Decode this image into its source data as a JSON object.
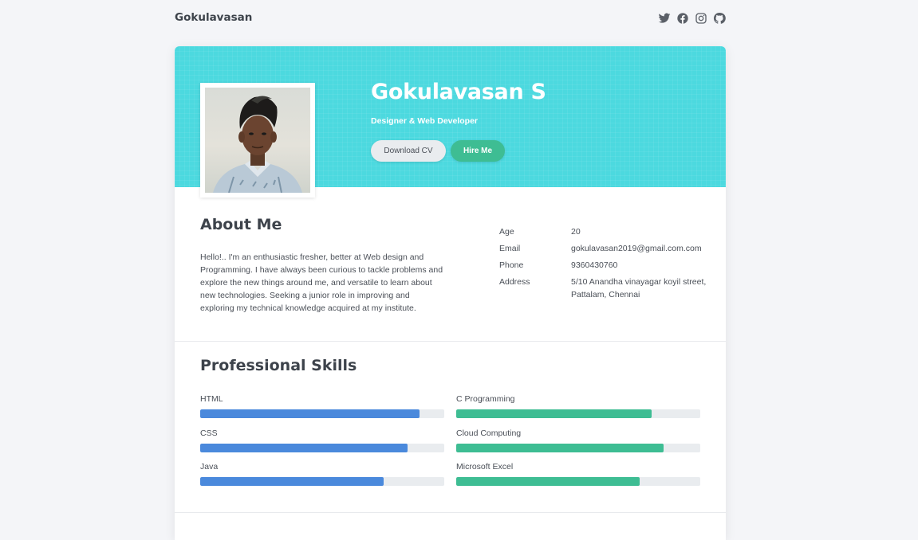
{
  "header": {
    "brand": "Gokulavasan",
    "social_icons": [
      "twitter-icon",
      "facebook-icon",
      "instagram-icon",
      "github-icon"
    ]
  },
  "profile": {
    "name": "Gokulavasan S",
    "role": "Designer & Web Developer",
    "download_label": "Download CV",
    "hire_label": "Hire Me"
  },
  "about": {
    "title": "About Me",
    "text": "Hello!.. I'm an enthusiastic fresher, better at Web design and Programming. I have always been curious to tackle problems and explore the new things around me, and versatile to learn about new technologies. Seeking a junior role in improving and exploring my technical knowledge acquired at my institute.",
    "info": [
      {
        "label": "Age",
        "value": "20"
      },
      {
        "label": "Email",
        "value": "gokulavasan2019@gmail.com.com"
      },
      {
        "label": "Phone",
        "value": "9360430760"
      },
      {
        "label": "Address",
        "value": "5/10 Anandha vinayagar koyil street, Pattalam, Chennai"
      }
    ]
  },
  "skills": {
    "title": "Professional Skills",
    "left": [
      {
        "label": "HTML",
        "level": 90
      },
      {
        "label": "CSS",
        "level": 85
      },
      {
        "label": "Java",
        "level": 75
      }
    ],
    "right": [
      {
        "label": "C Programming",
        "level": 80
      },
      {
        "label": "Cloud Computing",
        "level": 85
      },
      {
        "label": "Microsoft Excel",
        "level": 75
      }
    ]
  },
  "colors": {
    "banner": "#4cd9df",
    "accent_green": "#3ebd93",
    "accent_blue": "#4a89dc",
    "track": "#e9ecef",
    "page_bg": "#f4f5f8"
  }
}
